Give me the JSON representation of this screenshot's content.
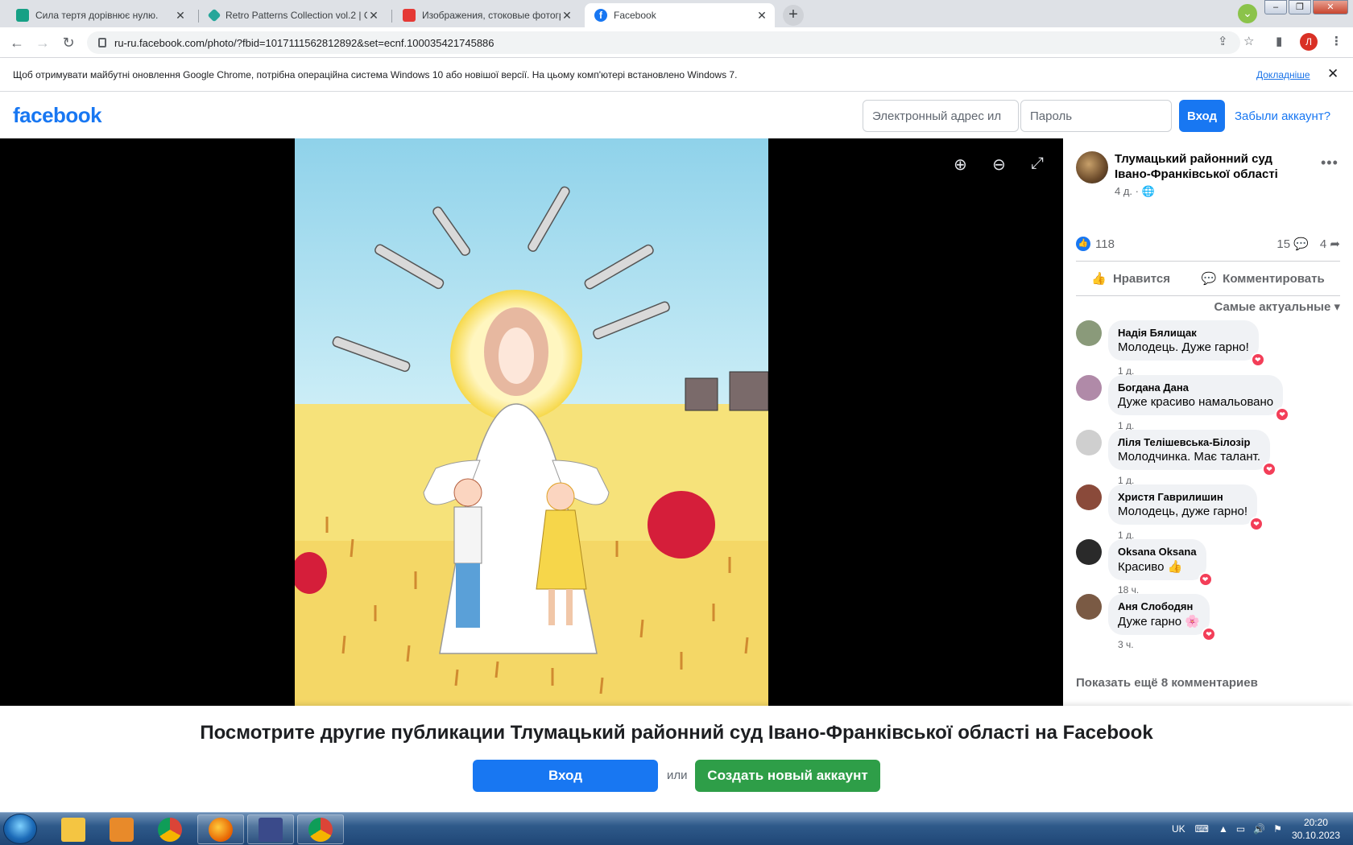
{
  "browser": {
    "tabs": [
      {
        "title": "Сила тертя дорівнює нулю.",
        "active": false
      },
      {
        "title": "Retro Patterns Collection vol.2 | C",
        "active": false
      },
      {
        "title": "Изображения, стоковые фотогр",
        "active": false
      },
      {
        "title": "Facebook",
        "active": true
      }
    ],
    "new_tab_label": "+",
    "tab_close_glyph": "✕",
    "address_url": "ru-ru.facebook.com/photo/?fbid=1017111562812892&set=ecnf.100035421745886",
    "profile_initial": "Л",
    "window_controls": [
      "–",
      "❐",
      "✕"
    ]
  },
  "infobar": {
    "message": "Щоб отримувати майбутні оновлення Google Chrome, потрібна операційна система Windows 10 або новішої версії. На цьому комп'ютері встановлено Windows 7.",
    "more_link": "Докладніше",
    "close_glyph": "✕"
  },
  "fb_header": {
    "logo": "facebook",
    "email_placeholder": "Электронный адрес ил",
    "password_placeholder": "Пароль",
    "login_button": "Вход",
    "forgot_link": "Забыли аккаунт?"
  },
  "post": {
    "page_name": "Тлумацький районний суд Івано-Франківської області",
    "time": "4 д.",
    "audience_icon": "globe-icon",
    "likes": "118",
    "comments_count": "15",
    "shares_count": "4",
    "like_action": "Нравится",
    "comment_action": "Комментировать",
    "sort_label": "Самые актуальные",
    "comments": [
      {
        "author": "Надія Бялищак",
        "text": "Молодець. Дуже гарно!",
        "time": "1 д.",
        "avatar_color": "#8a9a7a"
      },
      {
        "author": "Богдана Дана",
        "text": "Дуже красиво намальовано",
        "time": "1 д.",
        "avatar_color": "#b08aa8"
      },
      {
        "author": "Ліля Телішевська-Білозір",
        "text": "Молодчинка. Має талант.",
        "time": "1 д.",
        "avatar_color": "#cfcfcf"
      },
      {
        "author": "Христя Гаврилишин",
        "text": "Молодець, дуже гарно!",
        "time": "1 д.",
        "avatar_color": "#8a4a3a"
      },
      {
        "author": "Oksana Oksana",
        "text": "Красиво 👍",
        "time": "18 ч.",
        "avatar_color": "#2a2a2a"
      },
      {
        "author": "Аня Слободян",
        "text": "Дуже гарно 🌸",
        "time": "3 ч.",
        "avatar_color": "#7a5a44"
      }
    ],
    "show_more": "Показать ещё 8 комментариев"
  },
  "viewer": {
    "zoom_in_icon": "zoom-in-icon",
    "zoom_out_icon": "zoom-out-icon",
    "fullscreen_icon": "fullscreen-icon"
  },
  "banner": {
    "headline": "Посмотрите другие публикации Тлумацький районний суд Івано-Франківської області на Facebook",
    "login_button": "Вход",
    "or_text": "или",
    "signup_button": "Создать новый аккаунт"
  },
  "taskbar": {
    "language": "UK",
    "time": "20:20",
    "date": "30.10.2023"
  },
  "colors": {
    "fb_blue": "#1877f2",
    "fb_green": "#42b72a",
    "taskbar": "#2f5a8a"
  }
}
